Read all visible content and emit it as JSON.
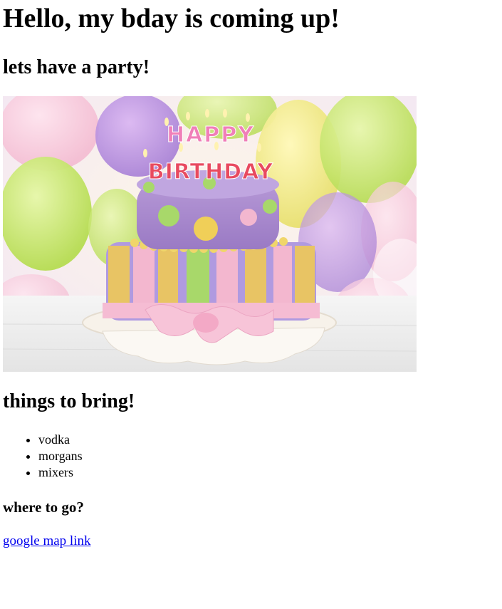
{
  "page": {
    "heading": "Hello, my bday is coming up!",
    "subheading": "lets have a party!",
    "image": {
      "cake_text_top": "HAPPY",
      "cake_text_bottom": "BIRTHDAY"
    },
    "bring_heading": "things to bring!",
    "bring_items": [
      "vodka",
      "morgans",
      "mixers"
    ],
    "where_heading": "where to go?",
    "map_link": "google map link"
  },
  "colors": {
    "link": "#0000ee",
    "text": "#000000",
    "background": "#ffffff"
  }
}
